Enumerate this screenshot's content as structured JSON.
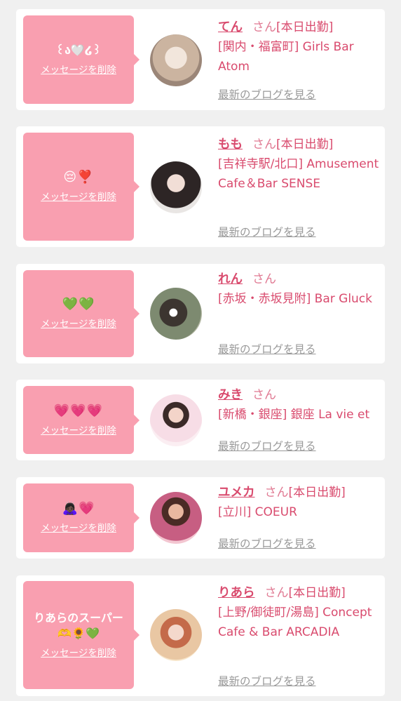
{
  "items": [
    {
      "message": "꒰ა🤍໒꒱",
      "delete_label": "メッセージを削除",
      "name": "てん",
      "honorific": "さん",
      "status": "[本日出勤]",
      "shop": "[関内・福富町] Girls Bar Atom",
      "blog_label": "最新のブログを見る",
      "avatar_color": "#d8c7b8"
    },
    {
      "message": "😔❣️",
      "delete_label": "メッセージを削除",
      "name": "もも",
      "honorific": "さん",
      "status": "[本日出勤]",
      "shop": "[吉祥寺駅/北口] Amusement Cafe＆Bar SENSE",
      "blog_label": "最新のブログを見る",
      "avatar_color": "#3a3030"
    },
    {
      "message": "💚💚",
      "delete_label": "メッセージを削除",
      "name": "れん",
      "honorific": "さん",
      "status": "",
      "shop": "[赤坂・赤坂見附] Bar Gluck",
      "blog_label": "最新のブログを見る",
      "avatar_color": "#6f7d66"
    },
    {
      "message": "💗💗💗",
      "delete_label": "メッセージを削除",
      "name": "みき",
      "honorific": "さん",
      "status": "",
      "shop": "[新橋・銀座] 銀座 La vie et",
      "blog_label": "最新のブログを見る",
      "avatar_color": "#f3d9e2"
    },
    {
      "message": "🙇🏿‍♀️💗",
      "delete_label": "メッセージを削除",
      "name": "ユメカ",
      "honorific": "さん",
      "status": "[本日出勤]",
      "shop": "[立川] COEUR",
      "blog_label": "最新のブログを見る",
      "avatar_color": "#c25d7a"
    },
    {
      "message": "りあらのスーパー🫶🌻💚",
      "delete_label": "メッセージを削除",
      "name": "りあら",
      "honorific": "さん",
      "status": "[本日出勤]",
      "shop": "[上野/御徒町/湯島] Concept Cafe & Bar ARCADIA",
      "blog_label": "最新のブログを見る",
      "avatar_color": "#e6b190"
    }
  ]
}
